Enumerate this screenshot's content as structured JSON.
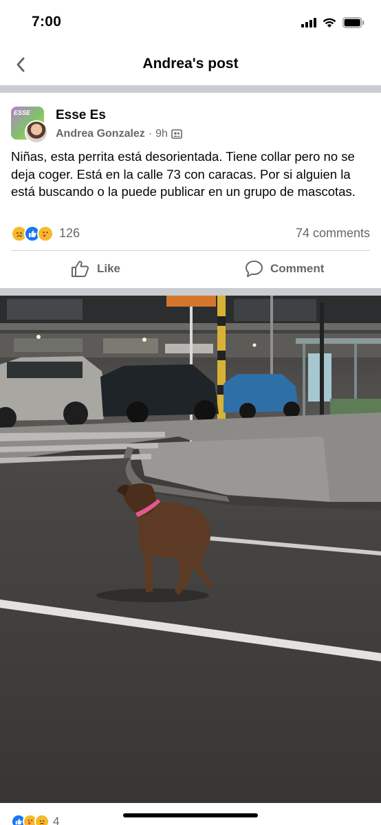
{
  "status_bar": {
    "time": "7:00"
  },
  "header": {
    "title": "Andrea's post"
  },
  "post": {
    "group_name": "Esse Es",
    "group_avatar_text": "ESSE",
    "author": "Andrea Gonzalez",
    "meta_sep": "·",
    "time_ago": "9h",
    "meta_sep2": "·",
    "text": "Niñas, esta perrita está desorientada. Tiene collar pero no se deja coger. Está en la calle 73 con caracas. Por si alguien la está buscando o la puede publicar en un grupo de mascotas.",
    "reaction_count": "126",
    "comment_count": "74 comments",
    "like_label": "Like",
    "comment_label": "Comment"
  },
  "next_post": {
    "reaction_count": "4"
  },
  "colors": {
    "accent": "#1877f2",
    "secondary_text": "#65676b",
    "separator": "#c9ccd1"
  },
  "icons": [
    "back-chevron-icon",
    "signal-icon",
    "wifi-icon",
    "battery-icon",
    "group-members-icon",
    "sad-reaction-icon",
    "like-reaction-icon",
    "care-reaction-icon",
    "like-thumb-icon",
    "comment-bubble-icon"
  ]
}
